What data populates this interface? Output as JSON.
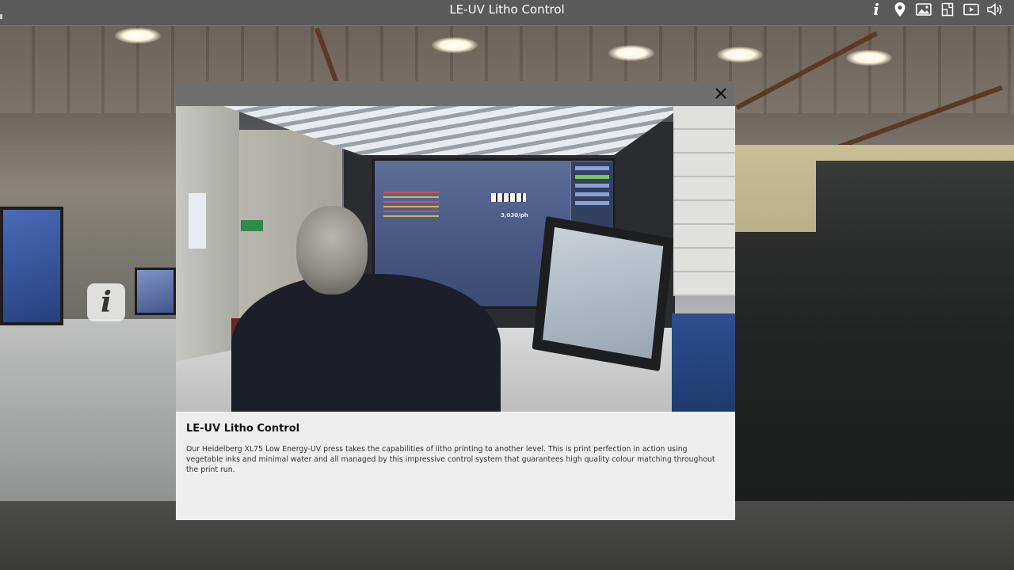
{
  "app": {
    "title": "LE-UV Litho Control"
  },
  "toolbar": {
    "items": [
      {
        "icon": "info-icon",
        "glyph": "i"
      },
      {
        "icon": "location-pin-icon"
      },
      {
        "icon": "gallery-icon"
      },
      {
        "icon": "floorplan-icon"
      },
      {
        "icon": "video-icon"
      },
      {
        "icon": "sound-icon"
      }
    ]
  },
  "hotspot": {
    "glyph": "i",
    "icon": "info-hotspot-icon"
  },
  "modal": {
    "close_glyph": "✕",
    "photo": {
      "icon": "press-control-photo",
      "screen_readout": "3,030/ph"
    },
    "title": "LE-UV Litho Control",
    "description": "Our Heidelberg XL75 Low Energy-UV press takes the capabilities of litho printing to another level. This is print perfection in action using vegetable inks and minimal water and all managed by this impressive control system that guarantees high quality colour matching throughout the print run."
  },
  "colors": {
    "topbar": "#5a5a5a",
    "modal_header": "#6f6f6f",
    "modal_body": "#eeeeee",
    "text": "#111111"
  }
}
